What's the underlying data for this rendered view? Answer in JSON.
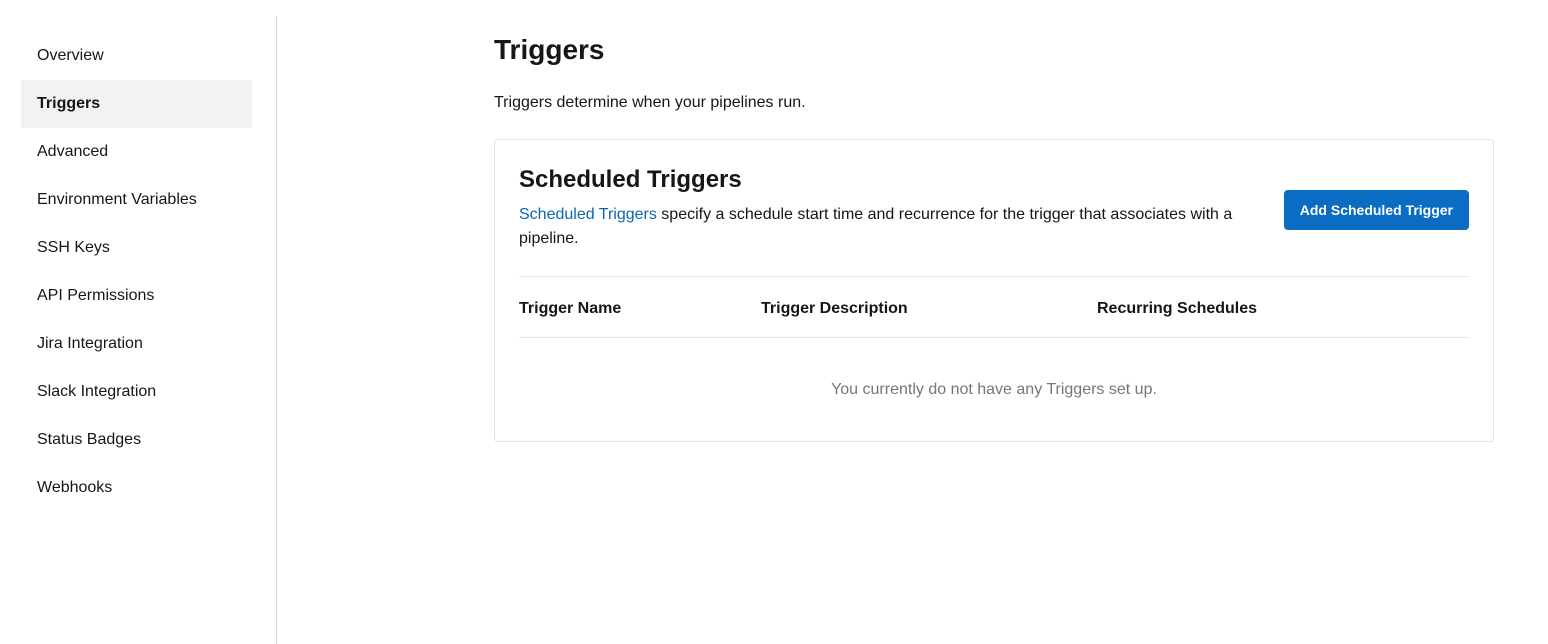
{
  "sidebar": {
    "items": [
      {
        "label": "Overview",
        "active": false
      },
      {
        "label": "Triggers",
        "active": true
      },
      {
        "label": "Advanced",
        "active": false
      },
      {
        "label": "Environment Variables",
        "active": false
      },
      {
        "label": "SSH Keys",
        "active": false
      },
      {
        "label": "API Permissions",
        "active": false
      },
      {
        "label": "Jira Integration",
        "active": false
      },
      {
        "label": "Slack Integration",
        "active": false
      },
      {
        "label": "Status Badges",
        "active": false
      },
      {
        "label": "Webhooks",
        "active": false
      }
    ]
  },
  "main": {
    "title": "Triggers",
    "description": "Triggers determine when your pipelines run.",
    "card": {
      "title": "Scheduled Triggers",
      "link_text": "Scheduled Triggers",
      "description_rest": " specify a schedule start time and recurrence for the trigger that associates with a pipeline.",
      "add_button_label": "Add Scheduled Trigger",
      "columns": [
        "Trigger Name",
        "Trigger Description",
        "Recurring Schedules"
      ],
      "empty_message": "You currently do not have any Triggers set up."
    }
  },
  "colors": {
    "accent": "#0a6cc2",
    "link": "#0b66b0",
    "active_bg": "#f2f2f2",
    "muted_text": "#767676"
  }
}
